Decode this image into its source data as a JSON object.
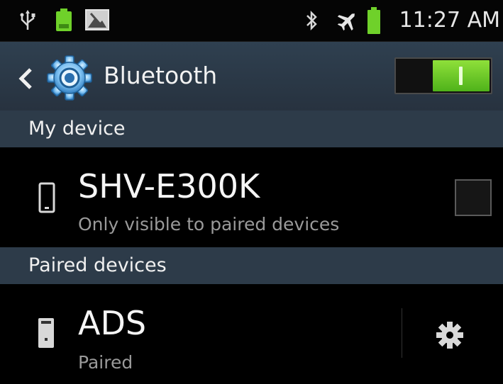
{
  "status_bar": {
    "icons_left": [
      "usb-icon",
      "battery-app-icon",
      "image-notification-icon"
    ],
    "icons_right": [
      "bluetooth-icon",
      "airplane-icon",
      "battery-icon"
    ],
    "time": "11:27 AM",
    "accent_green": "#6fd12a"
  },
  "action_bar": {
    "title": "Bluetooth",
    "back_icon": "chevron-left-icon",
    "app_icon": "settings-gear-icon",
    "switch_state": "on",
    "switch_color": "#6fd12a"
  },
  "sections": {
    "my_device": "My device",
    "paired_devices": "Paired devices"
  },
  "my_device": {
    "name": "SHV-E300K",
    "visibility": "Only visible to paired devices",
    "icon": "phone-icon",
    "visible_checked": false
  },
  "paired": [
    {
      "name": "ADS",
      "status": "Paired",
      "icon": "computer-icon",
      "settings_icon": "gear-icon"
    }
  ],
  "colors": {
    "header_bg": "#2d3b49",
    "background": "#000000",
    "text_secondary": "#9a9a9a"
  }
}
